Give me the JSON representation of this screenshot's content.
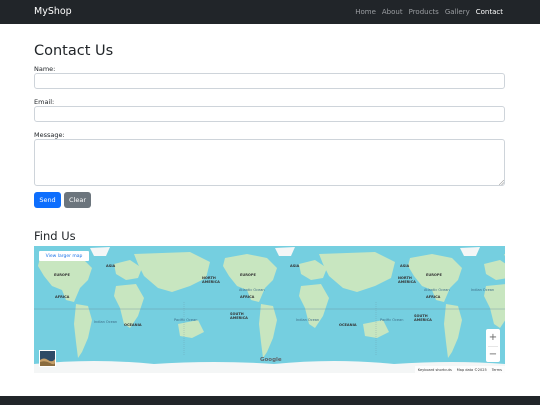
{
  "navbar": {
    "brand": "MyShop",
    "links": [
      {
        "label": "Home",
        "active": false
      },
      {
        "label": "About",
        "active": false
      },
      {
        "label": "Products",
        "active": false
      },
      {
        "label": "Gallery",
        "active": false
      },
      {
        "label": "Contact",
        "active": true
      }
    ]
  },
  "contact": {
    "title": "Contact Us",
    "name_label": "Name:",
    "name_value": "",
    "email_label": "Email:",
    "email_value": "",
    "message_label": "Message:",
    "message_value": "",
    "send_label": "Send",
    "clear_label": "Clear"
  },
  "find": {
    "title": "Find Us"
  },
  "map": {
    "larger_map_label": "View larger map",
    "zoom_in": "+",
    "zoom_out": "−",
    "google": "Google",
    "attribution": [
      "Keyboard shortcuts",
      "Map data ©2025",
      "Terms"
    ],
    "labels": [
      "ASIA",
      "EUROPE",
      "AFRICA",
      "NORTH AMERICA",
      "SOUTH AMERICA",
      "OCEANIA"
    ],
    "oceans": [
      "Atlantic Ocean",
      "Pacific Ocean",
      "Indian Ocean"
    ],
    "colors": {
      "water": "#75cfe0",
      "land": "#c8e6c0",
      "ice": "#f4f6f6"
    }
  }
}
